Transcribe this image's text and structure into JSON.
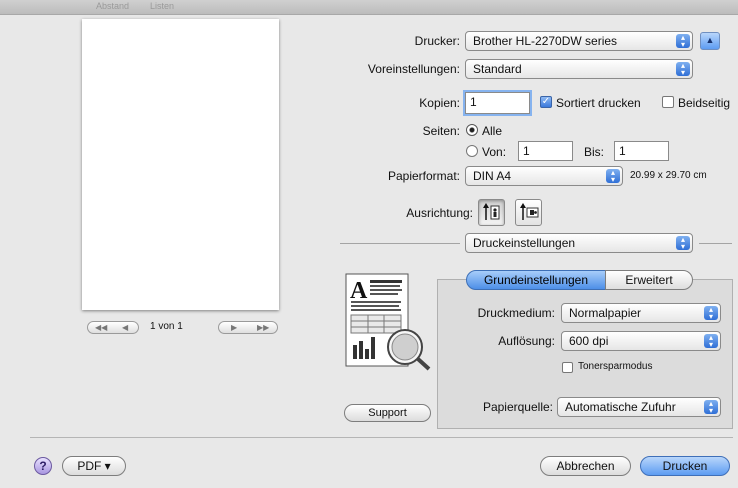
{
  "window": {
    "toolbar_ghost": [
      "Abstand",
      "Listen"
    ]
  },
  "preview": {
    "page_label": "1 von 1",
    "nav": {
      "first": "◀◀",
      "prev": "◀",
      "next": "▶",
      "last": "▶▶"
    }
  },
  "printer": {
    "label": "Drucker:",
    "value": "Brother HL-2270DW series"
  },
  "presets": {
    "label": "Voreinstellungen:",
    "value": "Standard"
  },
  "copies": {
    "label": "Kopien:",
    "value": "1",
    "collate_label": "Sortiert drucken",
    "collate_checked": true,
    "duplex_label": "Beidseitig",
    "duplex_checked": false
  },
  "pages": {
    "label": "Seiten:",
    "all_label": "Alle",
    "from_label": "Von:",
    "from_value": "1",
    "to_label": "Bis:",
    "to_value": "1",
    "selected": "all"
  },
  "paper": {
    "label": "Papierformat:",
    "value": "DIN A4",
    "size": "20.99 x 29.70 cm"
  },
  "orientation": {
    "label": "Ausrichtung:",
    "selected": "portrait"
  },
  "section": {
    "value": "Druckeinstellungen"
  },
  "tabs": [
    {
      "label": "Grundeinstellungen",
      "selected": true
    },
    {
      "label": "Erweitert",
      "selected": false
    }
  ],
  "settings": {
    "media_label": "Druckmedium:",
    "media_value": "Normalpapier",
    "resolution_label": "Auflösung:",
    "resolution_value": "600 dpi",
    "toner_label": "Tonersparmodus",
    "toner_checked": false,
    "source_label": "Papierquelle:",
    "source_value": "Automatische Zufuhr"
  },
  "support_button": "Support",
  "footer": {
    "help": "?",
    "pdf_label": "PDF ▾",
    "cancel_label": "Abbrechen",
    "print_label": "Drucken"
  },
  "colors": {
    "accent": "#4e8fe8",
    "background": "#e8e8e8"
  }
}
